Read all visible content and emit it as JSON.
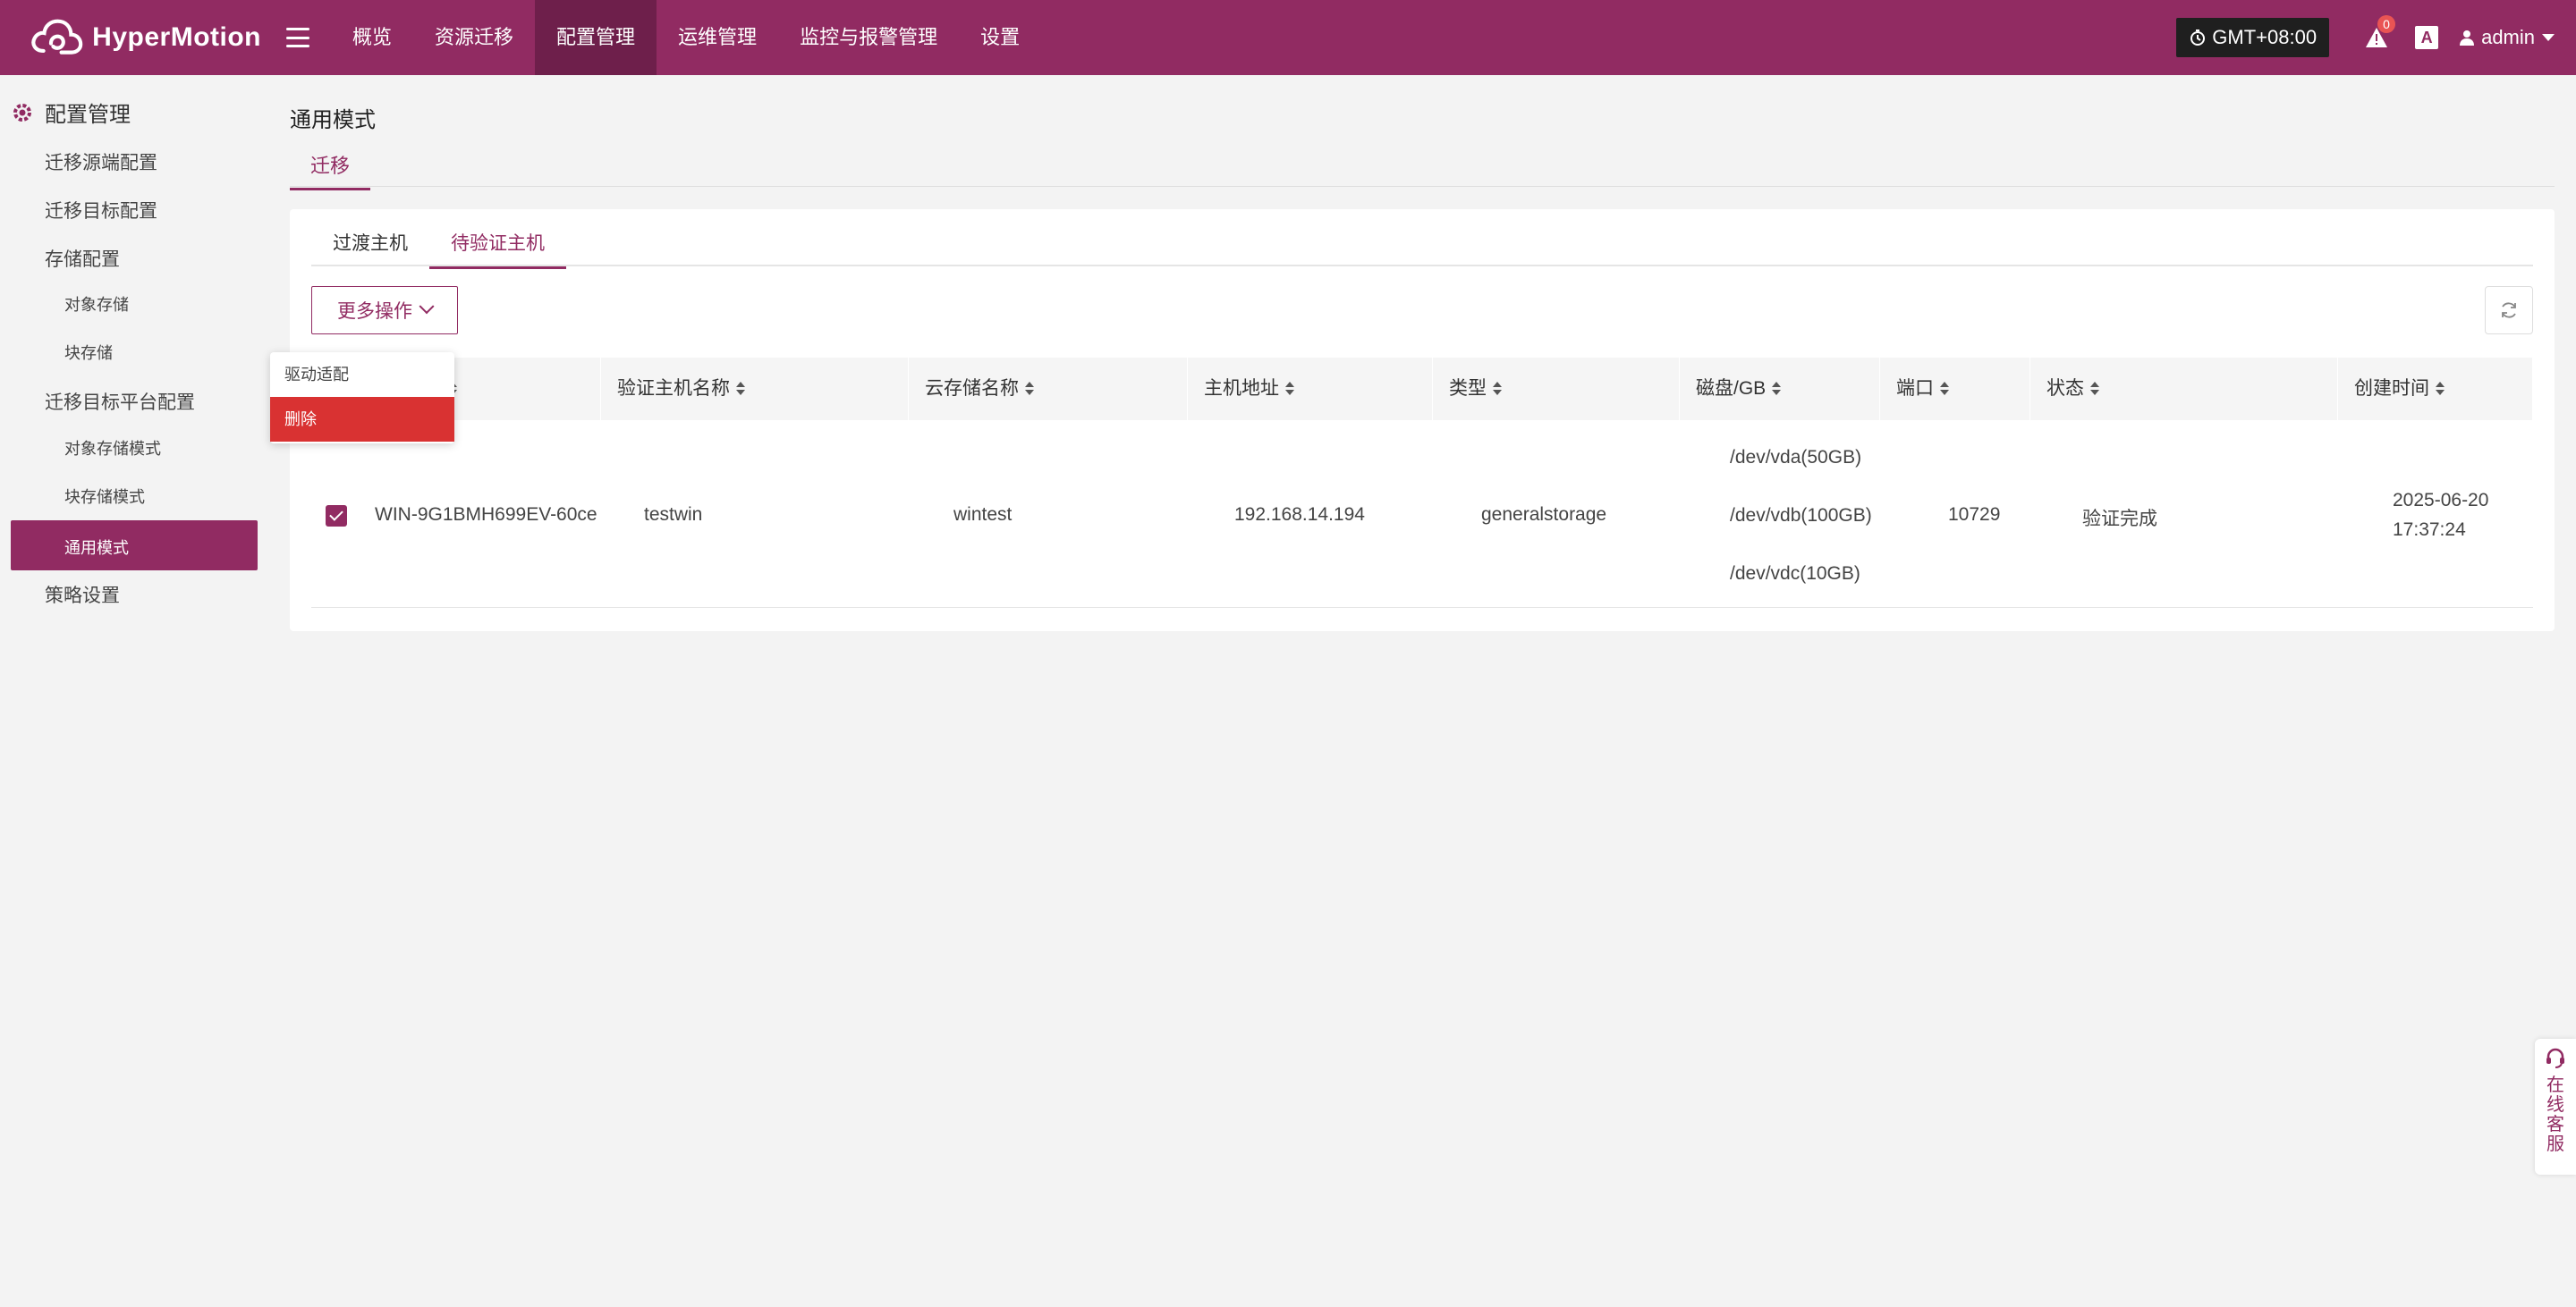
{
  "app": {
    "name": "HyperMotion"
  },
  "nav": {
    "items": [
      "概览",
      "资源迁移",
      "配置管理",
      "运维管理",
      "监控与报警管理",
      "设置"
    ],
    "active_index": 2
  },
  "header": {
    "timezone": "GMT+08:00",
    "alert_count": "0",
    "font_icon": "A",
    "user": "admin"
  },
  "sidebar": {
    "title": "配置管理",
    "items": {
      "source": "迁移源端配置",
      "target": "迁移目标配置",
      "storage": "存储配置",
      "object_storage": "对象存储",
      "block_storage": "块存储",
      "platform": "迁移目标平台配置",
      "object_mode": "对象存储模式",
      "block_mode": "块存储模式",
      "general_mode": "通用模式",
      "policy": "策略设置"
    }
  },
  "main": {
    "page_title": "通用模式",
    "tab": "迁移",
    "subtabs": [
      "过渡主机",
      "待验证主机"
    ],
    "subtab_active": 1,
    "more_button": "更多操作",
    "dropdown": {
      "driver": "驱动适配",
      "delete": "删除"
    },
    "table": {
      "headers": [
        "验证主机名称",
        "云存储名称",
        "主机地址",
        "类型",
        "磁盘/GB",
        "端口",
        "状态",
        "创建时间"
      ],
      "rows": [
        {
          "host": "WIN-9G1BMH699EV-60ce",
          "verify_name": "testwin",
          "cloud_storage": "wintest",
          "address": "192.168.14.194",
          "type": "generalstorage",
          "disks": [
            "/dev/vda(50GB)",
            "/dev/vdb(100GB)",
            "/dev/vdc(10GB)"
          ],
          "port": "10729",
          "status": "验证完成",
          "created_date": "2025-06-20",
          "created_time": "17:37:24"
        }
      ]
    }
  },
  "service": {
    "label": "在线客服"
  },
  "colors": {
    "brand": "#912b62",
    "brand_dark": "#6e1f4b",
    "danger": "#d93232"
  }
}
